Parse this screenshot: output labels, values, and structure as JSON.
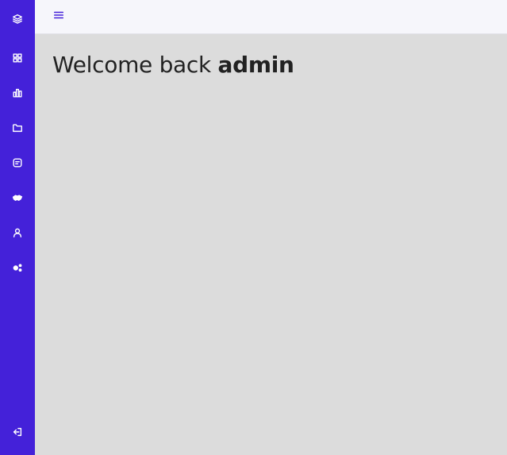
{
  "sidebar": {
    "background": "#4421d9",
    "items": [
      {
        "icon": "layers-icon",
        "label": ""
      },
      {
        "icon": "dashboard-grid-icon",
        "label": ""
      },
      {
        "icon": "bar-chart-icon",
        "label": ""
      },
      {
        "icon": "folder-icon",
        "label": ""
      },
      {
        "icon": "message-icon",
        "label": ""
      },
      {
        "icon": "handshake-icon",
        "label": ""
      },
      {
        "icon": "user-icon",
        "label": ""
      },
      {
        "icon": "settings-gears-icon",
        "label": ""
      }
    ],
    "footer_icon": "logout-icon"
  },
  "topbar": {
    "menu_icon": "menu-icon",
    "accent": "#4421d9"
  },
  "main": {
    "greeting": "Welcome back ",
    "username": "admin"
  }
}
